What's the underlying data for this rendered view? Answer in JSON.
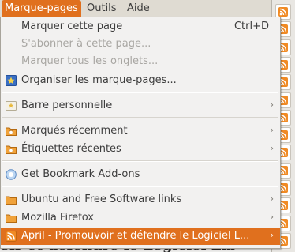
{
  "menubar": {
    "items": [
      {
        "label": "Marque-pages",
        "active": true
      },
      {
        "label": "Outils",
        "active": false
      },
      {
        "label": "Aide",
        "active": false
      }
    ]
  },
  "menu": {
    "items": [
      {
        "label": "Marquer cette page",
        "shortcut": "Ctrl+D",
        "disabled": false,
        "icon": "none"
      },
      {
        "label": "S'abonner à cette page...",
        "disabled": true,
        "icon": "none"
      },
      {
        "label": "Marquer tous les onglets...",
        "disabled": true,
        "icon": "none"
      },
      {
        "label": "Organiser les marque-pages...",
        "disabled": false,
        "icon": "bookmarks-organize-icon"
      },
      {
        "label": "Barre personnelle",
        "submenu": true,
        "icon": "bookmarks-toolbar-icon"
      },
      {
        "label": "Marqués récemment",
        "submenu": true,
        "icon": "smart-folder-icon"
      },
      {
        "label": "Étiquettes récentes",
        "submenu": true,
        "icon": "smart-folder-icon"
      },
      {
        "label": "Get Bookmark Add-ons",
        "submenu": false,
        "icon": "addons-icon"
      },
      {
        "label": "Ubuntu and Free Software links",
        "submenu": true,
        "icon": "folder-icon"
      },
      {
        "label": "Mozilla Firefox",
        "submenu": true,
        "icon": "folder-icon"
      },
      {
        "label": "April - Promouvoir et défendre le Logiciel L...",
        "submenu": true,
        "icon": "rss-feed-icon",
        "highlighted": true
      }
    ]
  },
  "background_text": "oir et défendre le Logiciel Lib",
  "colors": {
    "accent": "#e0701e",
    "rss": "#f08a24"
  }
}
